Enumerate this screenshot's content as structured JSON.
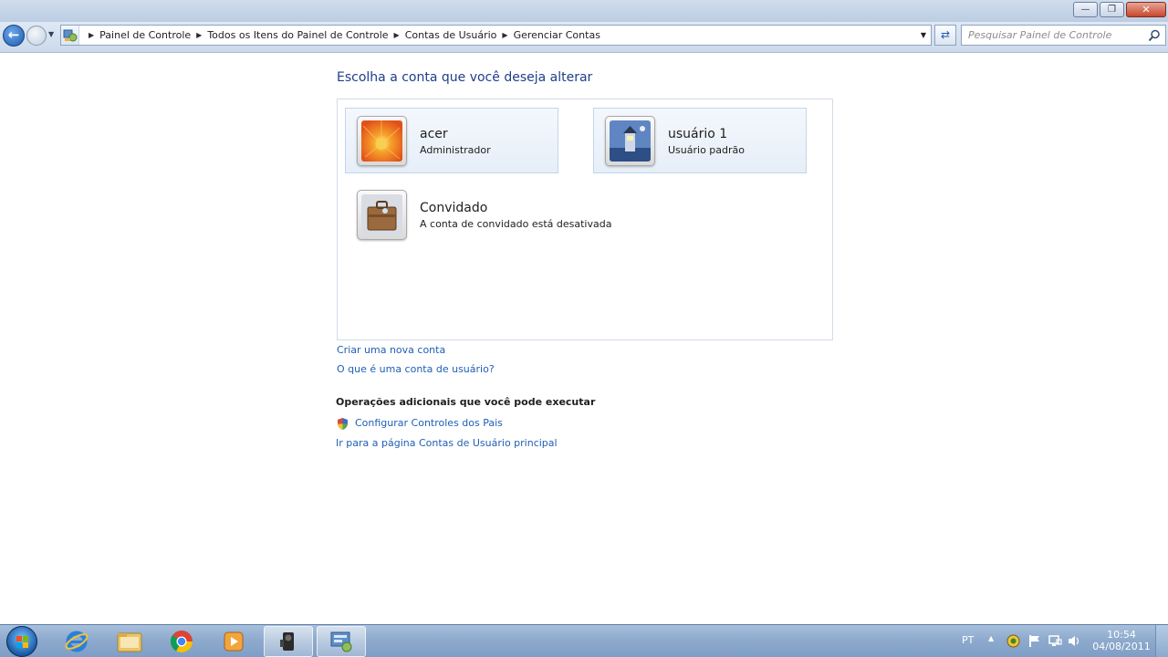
{
  "window": {
    "minimize_label": "—",
    "maximize_label": "❐",
    "close_label": "✕"
  },
  "nav": {
    "back_icon": "arrow-left-icon",
    "breadcrumbs": [
      "Painel de Controle",
      "Todos os Itens do Painel de Controle",
      "Contas de Usuário",
      "Gerenciar Contas"
    ],
    "search_placeholder": "Pesquisar Painel de Controle"
  },
  "page": {
    "title": "Escolha a conta que você deseja alterar",
    "accounts": [
      {
        "name": "acer",
        "role": "Administrador",
        "picture": "flower-picture"
      },
      {
        "name": "usuário 1",
        "role": "Usuário padrão",
        "picture": "lighthouse-picture"
      },
      {
        "name": "Convidado",
        "role": "A conta de convidado está desativada",
        "picture": "briefcase-picture"
      }
    ],
    "links": {
      "create_account": "Criar uma nova conta",
      "what_is_account": "O que é uma conta de usuário?"
    },
    "additional_heading": "Operações adicionais que você pode executar",
    "additional_links": {
      "parental_controls": "Configurar Controles dos Pais",
      "main_accounts_page": "Ir para a página Contas de Usuário principal"
    }
  },
  "taskbar": {
    "items": [
      "internet-explorer-icon",
      "windows-explorer-icon",
      "chrome-icon",
      "media-player-icon",
      "camcorder-app-icon",
      "control-panel-icon"
    ],
    "language": "PT",
    "time": "10:54",
    "date": "04/08/2011"
  },
  "colors": {
    "link": "#1f5fb5",
    "title": "#1e3e8a",
    "selected_bg": "#e6eef8"
  }
}
